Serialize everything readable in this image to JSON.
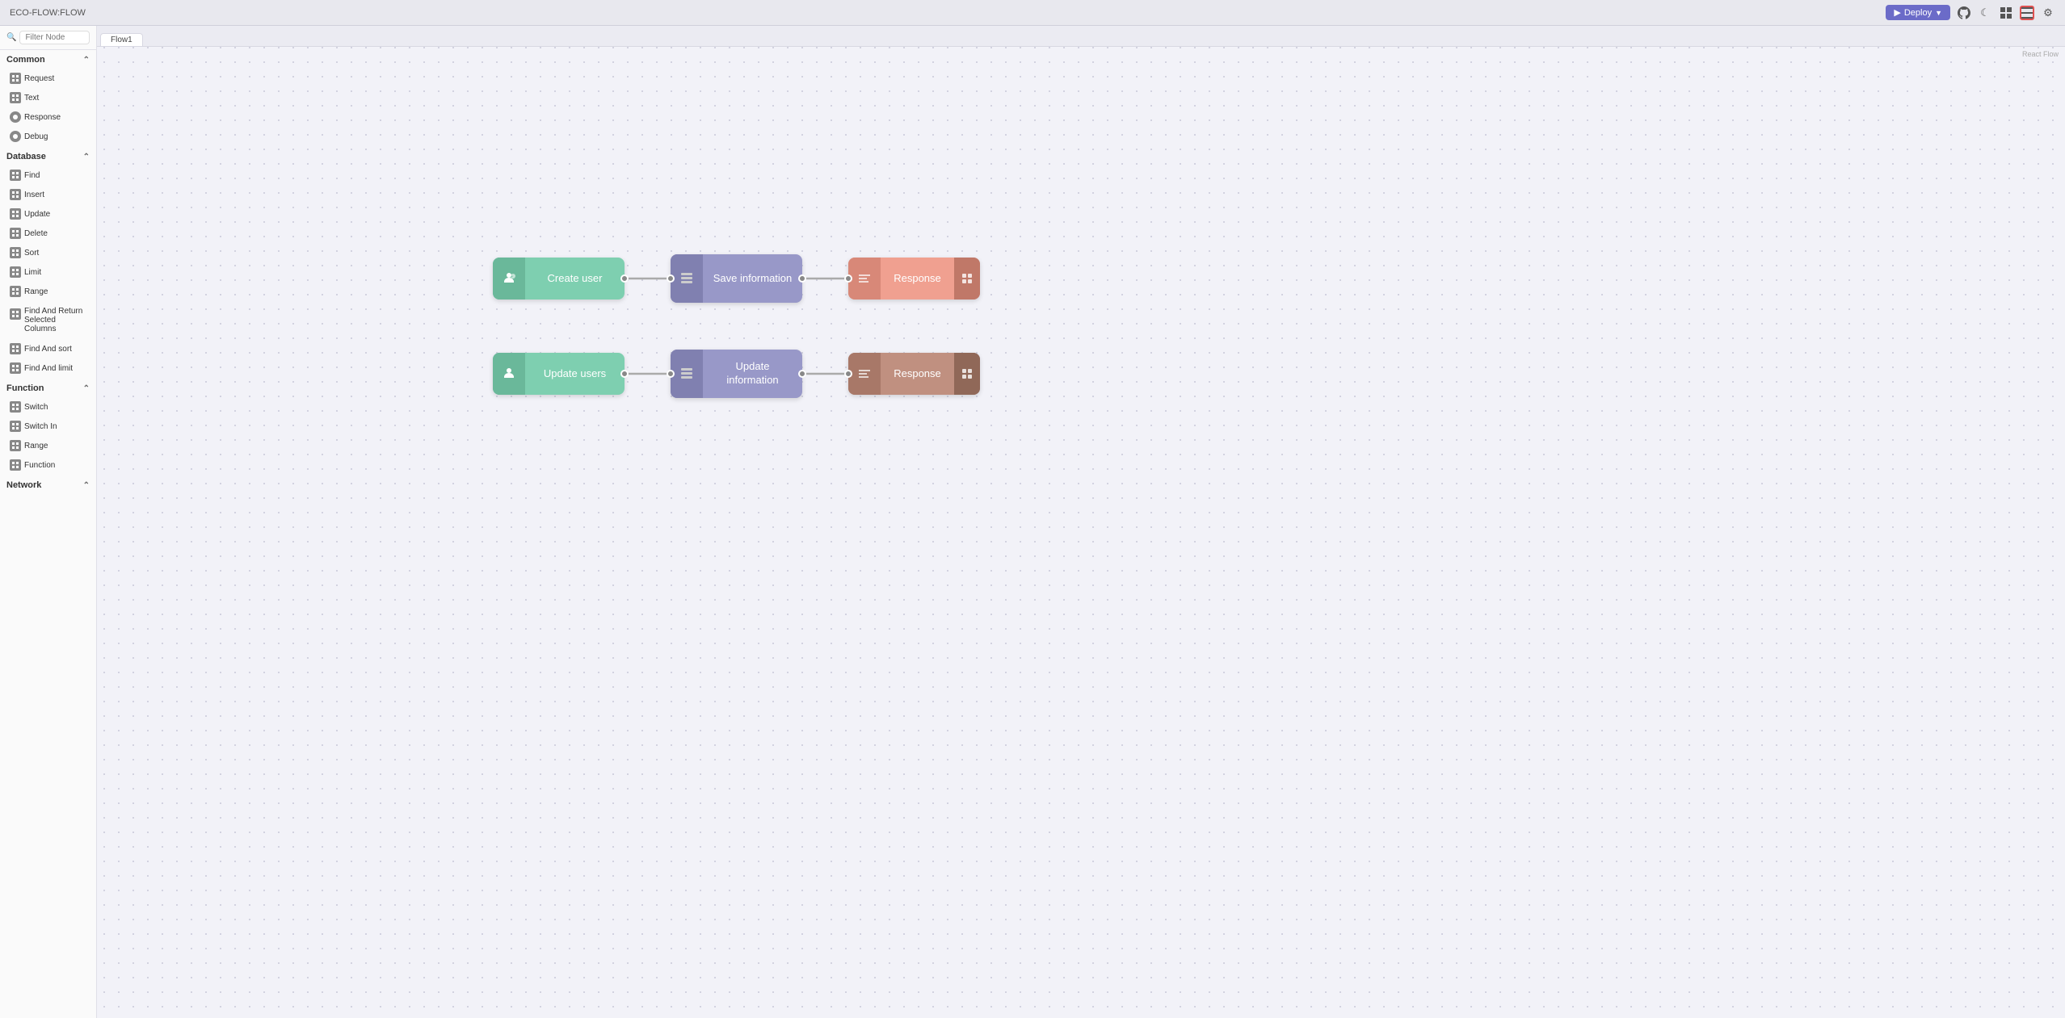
{
  "app": {
    "title": "ECO-FLOW:FLOW"
  },
  "topbar": {
    "title": "ECO-FLOW:FLOW",
    "deploy_label": "Deploy",
    "filter_placeholder": "Filter Node"
  },
  "tabs": [
    {
      "label": "Flow1"
    }
  ],
  "react_flow_label": "React Flow",
  "sidebar": {
    "filter_placeholder": "Filter Node",
    "sections": [
      {
        "name": "Common",
        "items": [
          {
            "label": "Request",
            "color": "green",
            "icon": "grid"
          },
          {
            "label": "Text",
            "color": "gray",
            "icon": "grid"
          },
          {
            "label": "Response",
            "color": "salmon",
            "icon": "circle"
          },
          {
            "label": "Debug",
            "color": "orange",
            "icon": "circle"
          }
        ]
      },
      {
        "name": "Database",
        "items": [
          {
            "label": "Find",
            "color": "gray",
            "icon": "grid"
          },
          {
            "label": "Insert",
            "color": "gray",
            "icon": "grid"
          },
          {
            "label": "Update",
            "color": "gray",
            "icon": "grid"
          },
          {
            "label": "Delete",
            "color": "gray",
            "icon": "grid"
          },
          {
            "label": "Sort",
            "color": "gray",
            "icon": "grid"
          },
          {
            "label": "Limit",
            "color": "gray",
            "icon": "grid"
          },
          {
            "label": "Range",
            "color": "gray",
            "icon": "grid"
          },
          {
            "label": "Find And Return Selected Columns",
            "color": "gray",
            "icon": "grid"
          },
          {
            "label": "Find And sort",
            "color": "gray",
            "icon": "grid"
          },
          {
            "label": "Find And limit",
            "color": "gray",
            "icon": "grid"
          }
        ]
      },
      {
        "name": "Function",
        "items": [
          {
            "label": "Switch",
            "color": "gray",
            "icon": "grid"
          },
          {
            "label": "Switch In",
            "color": "gray",
            "icon": "grid"
          },
          {
            "label": "Range",
            "color": "gray",
            "icon": "grid"
          },
          {
            "label": "Function",
            "color": "gray",
            "icon": "grid"
          }
        ]
      },
      {
        "name": "Network",
        "items": []
      }
    ]
  },
  "flow_nodes": {
    "row1": {
      "create_user": {
        "label": "Create user"
      },
      "save_info": {
        "label": "Save information"
      },
      "response1": {
        "label": "Response"
      }
    },
    "row2": {
      "update_users": {
        "label": "Update users"
      },
      "update_info": {
        "label": "Update information"
      },
      "response2": {
        "label": "Response"
      }
    }
  }
}
